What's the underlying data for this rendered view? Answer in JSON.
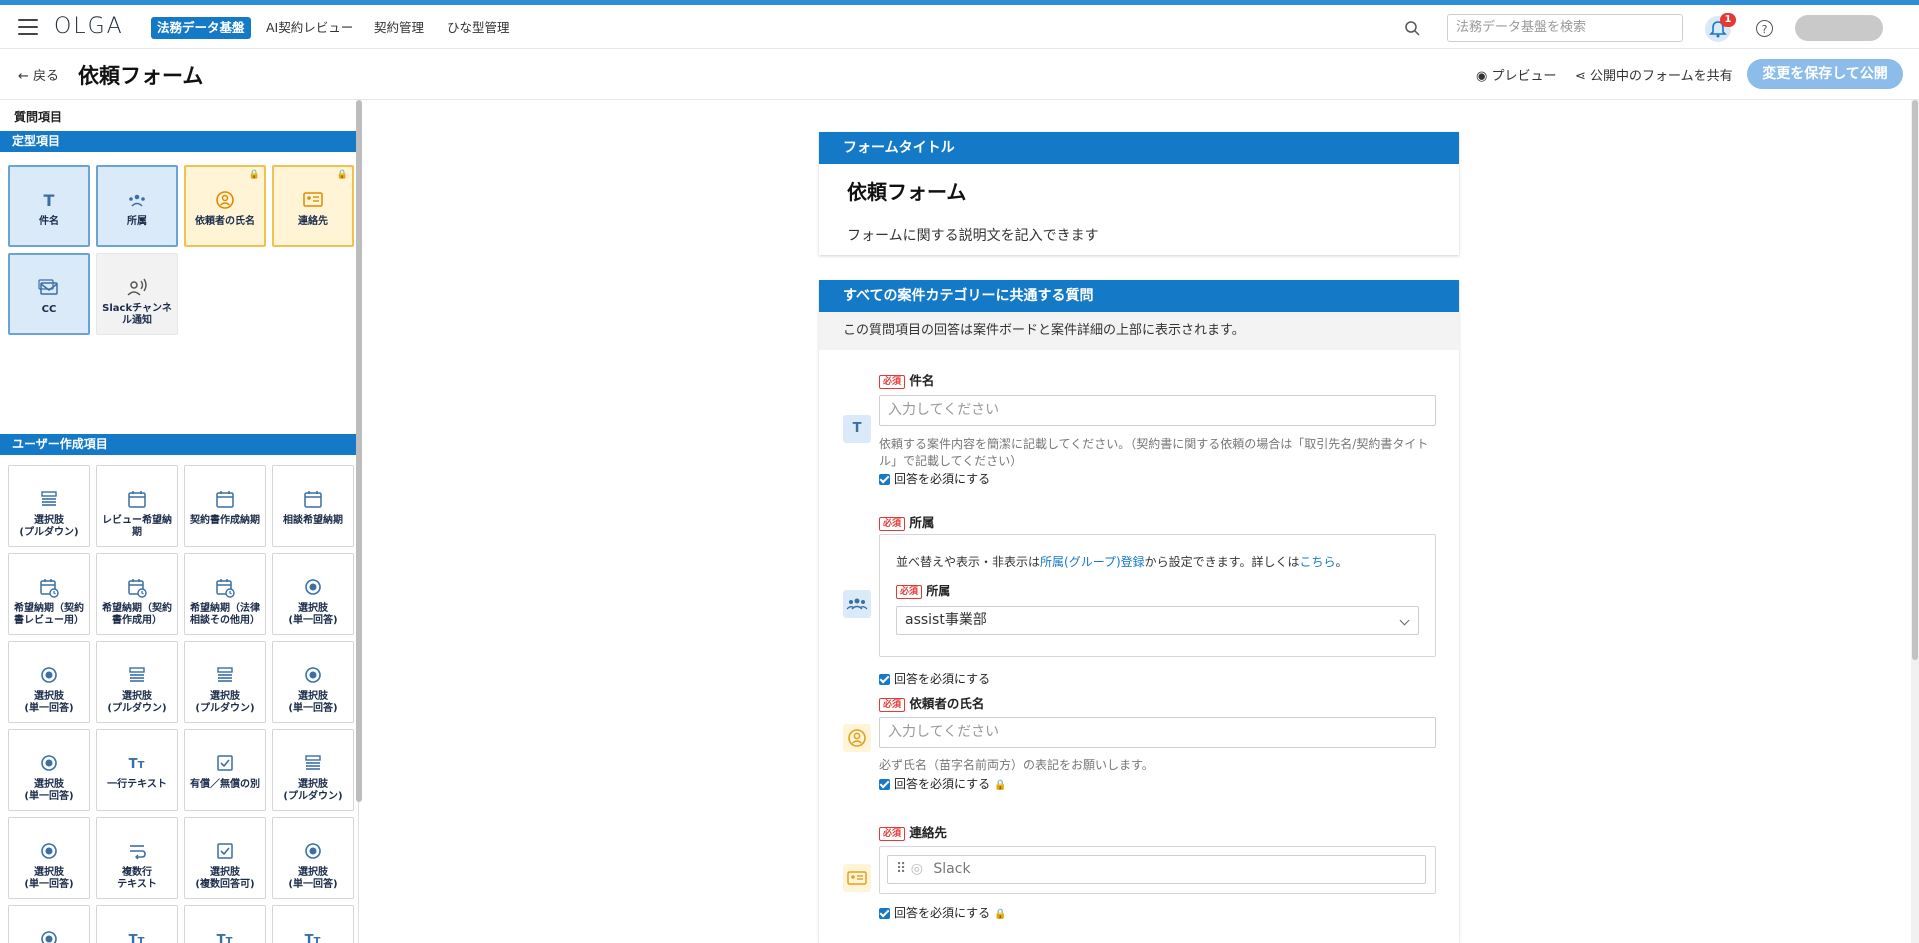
{
  "app": {
    "logo": "OLGA",
    "nav": [
      "法務データ基盤",
      "AI契約レビュー",
      "契約管理",
      "ひな型管理"
    ],
    "search_placeholder": "法務データ基盤を検索",
    "notification_count": "1",
    "help": "?"
  },
  "page": {
    "back": "戻る",
    "title": "依頼フォーム",
    "preview": "プレビュー",
    "share": "公開中のフォームを共有",
    "publish": "変更を保存して公開"
  },
  "sidebar": {
    "title": "質問項目",
    "fixed_section": "定型項目",
    "fixed_items": [
      {
        "label": "件名",
        "icon": "text-icon",
        "style": "blue"
      },
      {
        "label": "所属",
        "icon": "group-icon",
        "style": "blue"
      },
      {
        "label": "依頼者の氏名",
        "icon": "person-icon",
        "style": "yellow",
        "locked": true
      },
      {
        "label": "連絡先",
        "icon": "contact-card-icon",
        "style": "yellow",
        "locked": true
      },
      {
        "label": "CC",
        "icon": "mail-icon",
        "style": "blue"
      },
      {
        "label": "Slackチャンネル通知",
        "icon": "voice-icon",
        "style": "gray"
      }
    ],
    "user_section": "ユーザー作成項目",
    "user_items": [
      {
        "label": "選択肢\n(プルダウン)",
        "icon": "dropdown-icon"
      },
      {
        "label": "レビュー希望納期",
        "icon": "calendar-icon"
      },
      {
        "label": "契約書作成納期",
        "icon": "calendar-icon"
      },
      {
        "label": "相談希望納期",
        "icon": "calendar-icon"
      },
      {
        "label": "希望納期（契約書レビュー用）",
        "icon": "calendar-clock-icon"
      },
      {
        "label": "希望納期（契約書作成用）",
        "icon": "calendar-clock-icon"
      },
      {
        "label": "希望納期（法律相談その他用）",
        "icon": "calendar-clock-icon"
      },
      {
        "label": "選択肢\n(単一回答)",
        "icon": "radio-icon"
      },
      {
        "label": "選択肢\n(単一回答)",
        "icon": "radio-icon"
      },
      {
        "label": "選択肢\n(プルダウン)",
        "icon": "dropdown-icon"
      },
      {
        "label": "選択肢\n(プルダウン)",
        "icon": "dropdown-icon"
      },
      {
        "label": "選択肢\n(単一回答)",
        "icon": "radio-icon"
      },
      {
        "label": "選択肢\n(単一回答)",
        "icon": "radio-icon"
      },
      {
        "label": "一行テキスト",
        "icon": "text-size-icon"
      },
      {
        "label": "有償／無償の別",
        "icon": "checkbox-icon"
      },
      {
        "label": "選択肢\n(プルダウン)",
        "icon": "dropdown-icon"
      },
      {
        "label": "選択肢\n(単一回答)",
        "icon": "radio-icon"
      },
      {
        "label": "複数行\nテキスト",
        "icon": "multiline-icon"
      },
      {
        "label": "選択肢\n(複数回答可)",
        "icon": "checkbox-icon"
      },
      {
        "label": "選択肢\n(単一回答)",
        "icon": "radio-icon"
      },
      {
        "label": "",
        "icon": "radio-icon"
      },
      {
        "label": "",
        "icon": "text-size-icon"
      },
      {
        "label": "",
        "icon": "text-size-icon"
      },
      {
        "label": "",
        "icon": "text-size-icon"
      }
    ]
  },
  "form_title_card": {
    "header": "フォームタイトル",
    "title": "依頼フォーム",
    "description": "フォームに関する説明文を記入できます"
  },
  "common_card": {
    "header": "すべての案件カテゴリーに共通する質問",
    "info": "この質問項目の回答は案件ボードと案件詳細の上部に表示されます。",
    "required_tag": "必須",
    "required_check": "回答を必須にする",
    "q1": {
      "label": "件名",
      "placeholder": "入力してください",
      "help": "依頼する案件内容を簡潔に記載してください。（契約書に関する依頼の場合は「取引先名/契約書タイトル」で記載してください）"
    },
    "q2": {
      "label": "所属",
      "note_prefix": "並べ替えや表示・非表示は",
      "note_link": "所属(グループ)登録",
      "note_mid": "から設定できます。詳しくは",
      "note_link2": "こちら",
      "note_suffix": "。",
      "sub_label": "所属",
      "selected": "assist事業部"
    },
    "q3": {
      "label": "依頼者の氏名",
      "placeholder": "入力してください",
      "help": "必ず氏名（苗字名前両方）の表記をお願いします。"
    },
    "q4": {
      "label": "連絡先",
      "option": "Slack"
    }
  }
}
